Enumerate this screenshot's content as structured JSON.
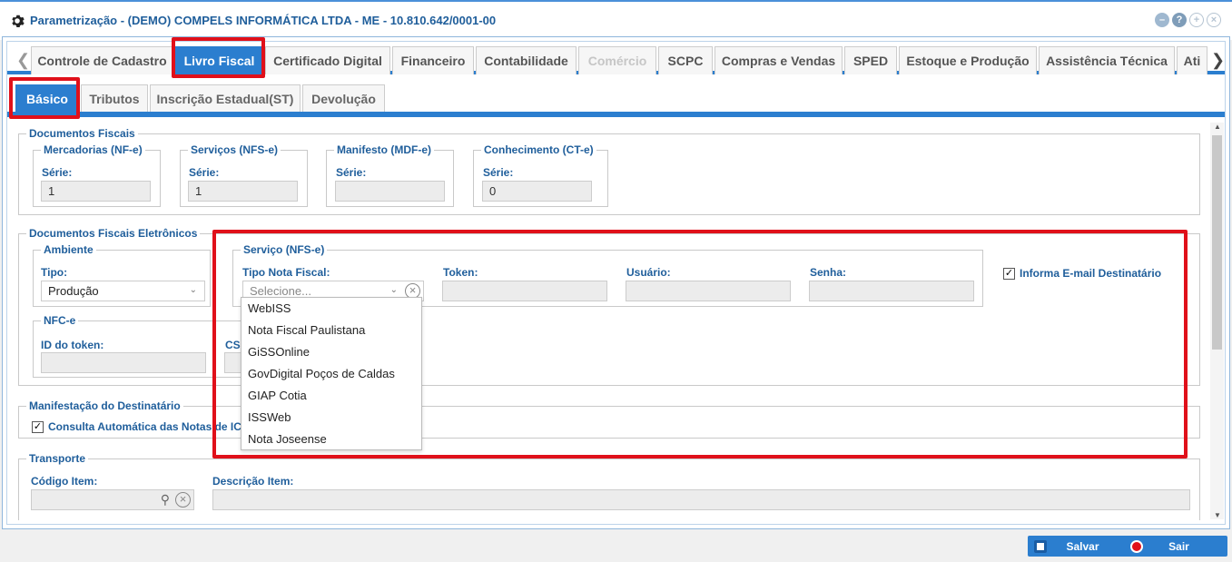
{
  "window": {
    "title": "Parametrização - (DEMO) COMPELS INFORMÁTICA LTDA - ME - 10.810.642/0001-00"
  },
  "main_tabs": [
    {
      "label": "Controle de Cadastro"
    },
    {
      "label": "Livro Fiscal"
    },
    {
      "label": "Certificado Digital"
    },
    {
      "label": "Financeiro"
    },
    {
      "label": "Contabilidade"
    },
    {
      "label": "Comércio"
    },
    {
      "label": "SCPC"
    },
    {
      "label": "Compras e Vendas"
    },
    {
      "label": "SPED"
    },
    {
      "label": "Estoque e Produção"
    },
    {
      "label": "Assistência Técnica"
    },
    {
      "label": "Ati"
    }
  ],
  "sub_tabs": [
    {
      "label": "Básico"
    },
    {
      "label": "Tributos"
    },
    {
      "label": "Inscrição Estadual(ST)"
    },
    {
      "label": "Devolução"
    }
  ],
  "docs_fiscais": {
    "legend": "Documentos Fiscais",
    "nfe": {
      "legend": "Mercadorias (NF-e)",
      "label": "Série:",
      "value": "1"
    },
    "nfse": {
      "legend": "Serviços (NFS-e)",
      "label": "Série:",
      "value": "1"
    },
    "mdfe": {
      "legend": "Manifesto (MDF-e)",
      "label": "Série:",
      "value": ""
    },
    "cte": {
      "legend": "Conhecimento (CT-e)",
      "label": "Série:",
      "value": "0"
    }
  },
  "dfe": {
    "legend": "Documentos Fiscais Eletrônicos",
    "ambiente": {
      "legend": "Ambiente",
      "tipo_label": "Tipo:",
      "tipo_value": "Produção"
    },
    "servico": {
      "legend": "Serviço (NFS-e)",
      "tipo_label": "Tipo Nota Fiscal:",
      "tipo_placeholder": "Selecione...",
      "token_label": "Token:",
      "usuario_label": "Usuário:",
      "senha_label": "Senha:"
    },
    "informa_email": {
      "label": "Informa E-mail Destinatário",
      "checked": true
    },
    "nfce": {
      "legend": "NFC-e",
      "id_token_label": "ID do token:",
      "csc_label": "CSC"
    }
  },
  "dropdown_options": [
    "WebISS",
    "Nota Fiscal Paulistana",
    "GiSSOnline",
    "GovDigital Poços de Caldas",
    "GIAP Cotia",
    "ISSWeb",
    "Nota Joseense"
  ],
  "manifestacao": {
    "legend": "Manifestação do Destinatário",
    "consulta_label": "Consulta Automática das Notas de ICMS",
    "checked": true
  },
  "transporte": {
    "legend": "Transporte",
    "codigo_label": "Código Item:",
    "descricao_label": "Descrição Item:"
  },
  "footer": {
    "save_label": "Salvar",
    "exit_label": "Sair"
  },
  "colors": {
    "accent": "#2b7ecf",
    "highlight": "#e0101a",
    "title": "#1f5e9b"
  }
}
